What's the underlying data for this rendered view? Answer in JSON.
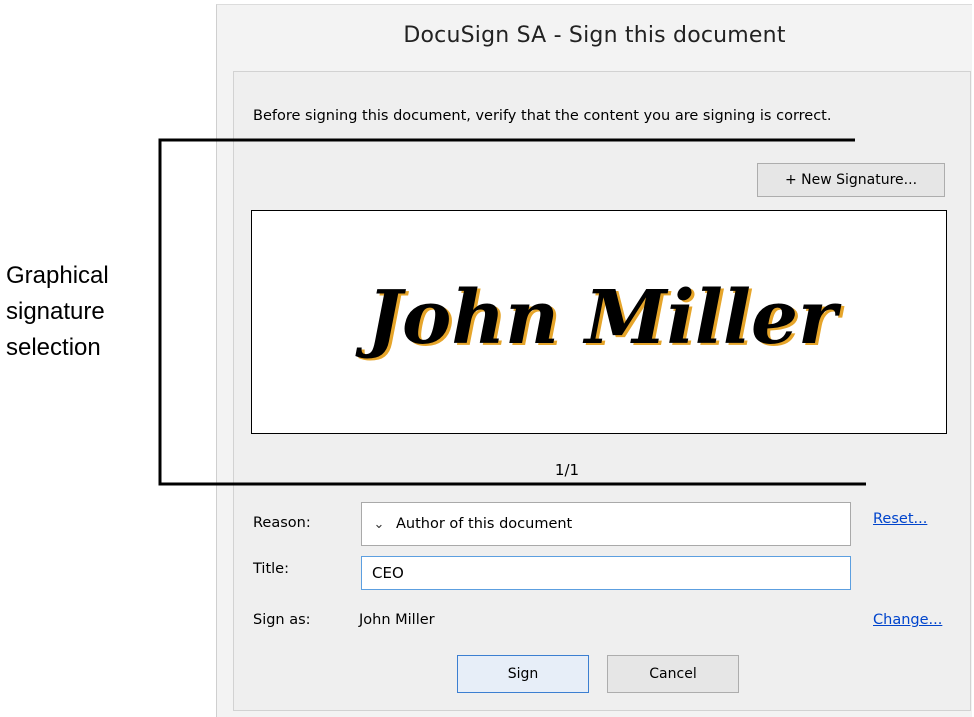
{
  "annotation": {
    "lines": [
      "Graphical",
      "signature",
      "selection"
    ]
  },
  "dialog": {
    "title": "DocuSign SA - Sign this document",
    "instruction": "Before signing this document, verify that the content you are signing is correct.",
    "new_signature_label": "+ New Signature...",
    "signature_text": "John Miller",
    "signature_counter": "1/1",
    "reason": {
      "label": "Reason:",
      "value": "Author of this document",
      "reset_link": "Reset..."
    },
    "title_field": {
      "label": "Title:",
      "value": "CEO"
    },
    "sign_as": {
      "label": "Sign as:",
      "value": "John Miller",
      "change_link": "Change..."
    },
    "buttons": {
      "sign": "Sign",
      "cancel": "Cancel"
    }
  },
  "icons": {
    "reason_dropdown": "chevron-down-icon"
  },
  "colors": {
    "link": "#0044cc",
    "focus_border": "#5c9fe0",
    "dialog_background": "#f3f3f3"
  }
}
